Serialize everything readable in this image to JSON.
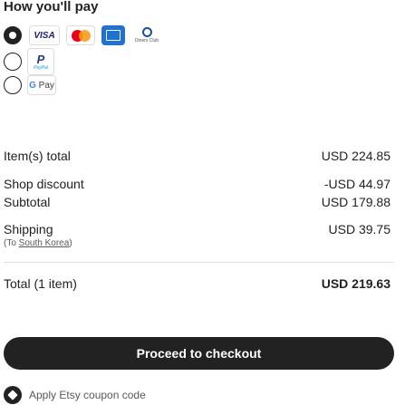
{
  "payment": {
    "title": "How you'll pay",
    "options": [
      {
        "id": "card",
        "selected": true,
        "logos": [
          "visa-logo",
          "mastercard-logo",
          "amex-logo",
          "diners-club-logo"
        ],
        "visa_text": "VISA",
        "diners_text": "Diners Club"
      },
      {
        "id": "paypal",
        "selected": false,
        "logo_text": "P",
        "logo_subtext": "PayPal"
      },
      {
        "id": "gpay",
        "selected": false,
        "logo_text_g": "G",
        "logo_text_pay": "Pay"
      }
    ]
  },
  "summary": {
    "items_total_label": "Item(s) total",
    "items_total_value": "USD 224.85",
    "shop_discount_label": "Shop discount",
    "shop_discount_value": "-USD 44.97",
    "subtotal_label": "Subtotal",
    "subtotal_value": "USD 179.88",
    "shipping_label": "Shipping",
    "shipping_value": "USD 39.75",
    "shipping_to_prefix": "(To ",
    "shipping_to_country": "South Korea",
    "shipping_to_suffix": ")",
    "total_label": "Total (1 item)",
    "total_value": "USD 219.63"
  },
  "checkout_button_label": "Proceed to checkout",
  "coupon_label": "Apply Etsy coupon code"
}
